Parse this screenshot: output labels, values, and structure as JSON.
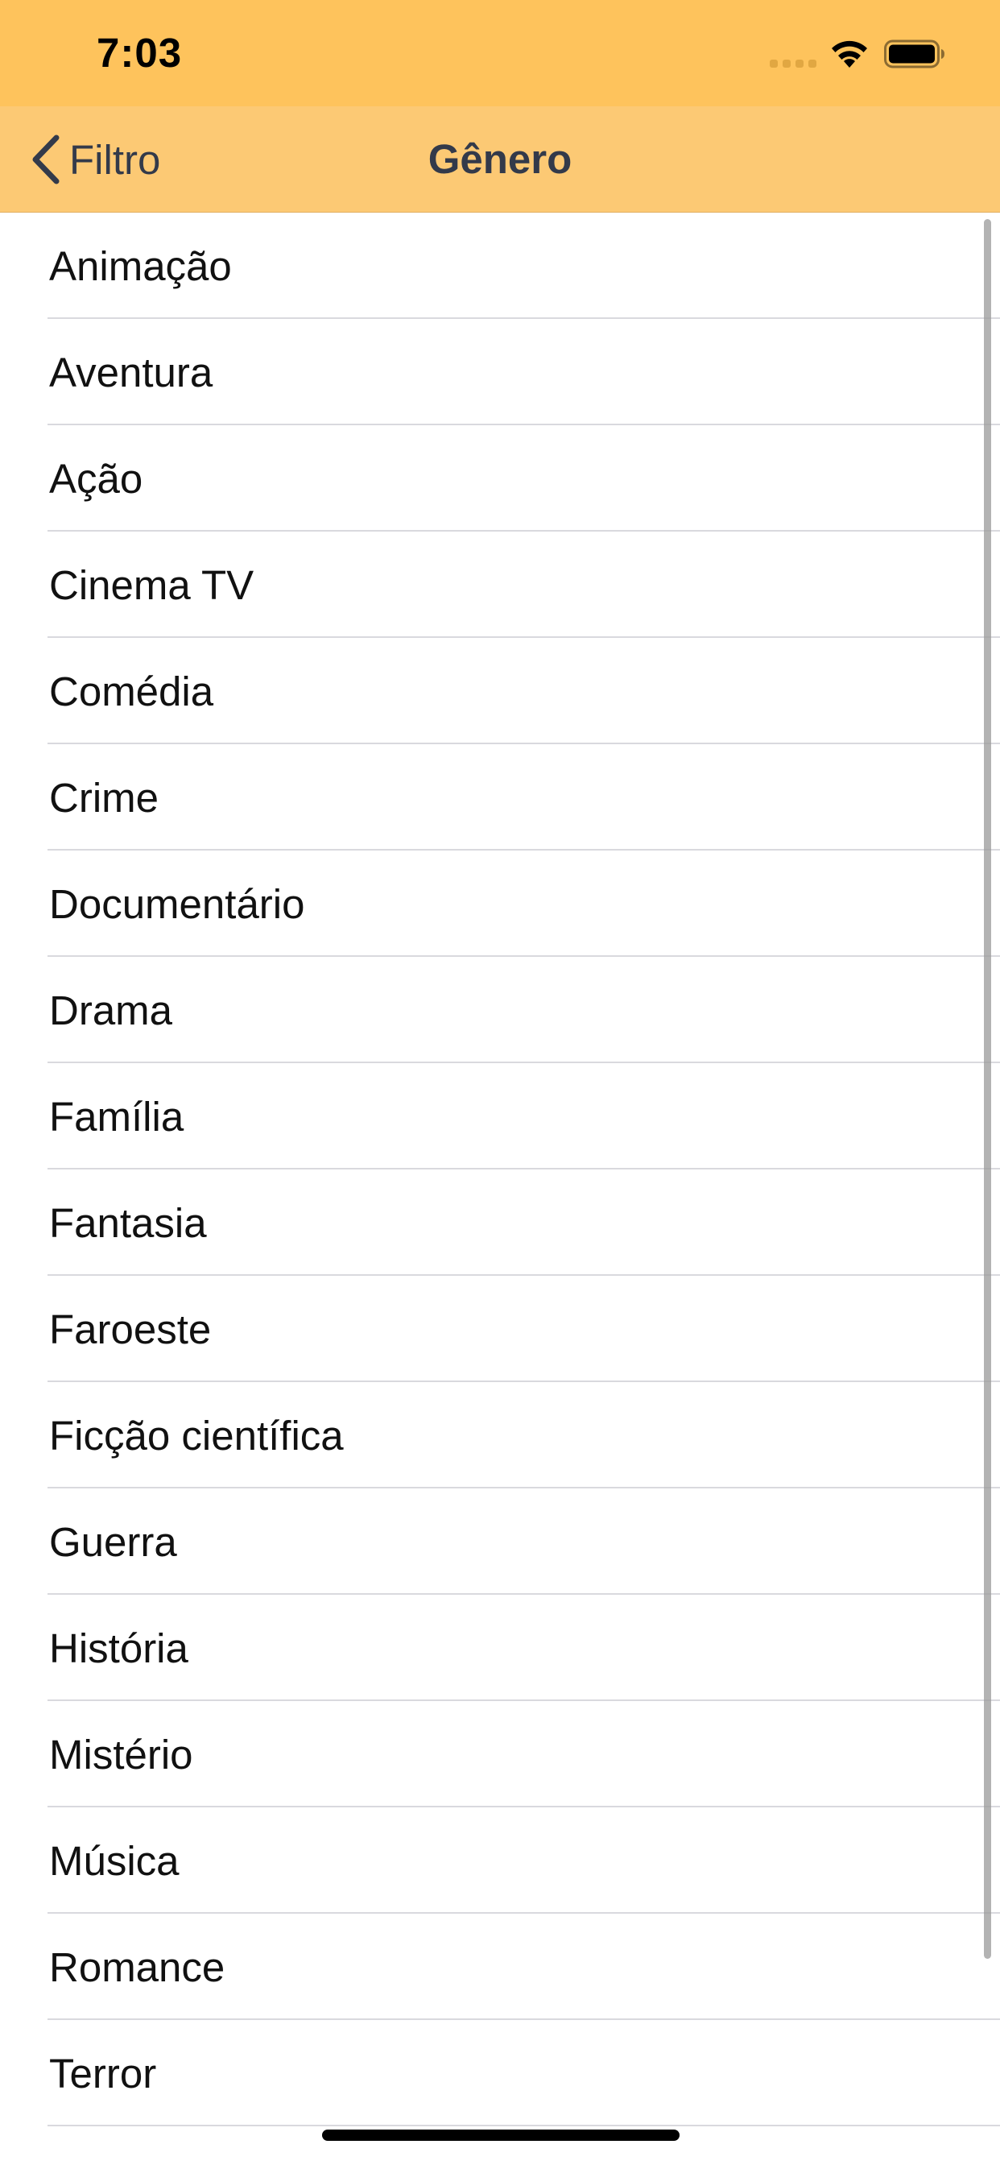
{
  "status_bar": {
    "time": "7:03",
    "icons": [
      "signal-icon",
      "wifi-icon",
      "battery-icon"
    ]
  },
  "nav": {
    "back_label": "Filtro",
    "title": "Gênero"
  },
  "genres": [
    {
      "label": "Animação"
    },
    {
      "label": "Aventura"
    },
    {
      "label": "Ação"
    },
    {
      "label": "Cinema TV"
    },
    {
      "label": "Comédia"
    },
    {
      "label": "Crime"
    },
    {
      "label": "Documentário"
    },
    {
      "label": "Drama"
    },
    {
      "label": "Família"
    },
    {
      "label": "Fantasia"
    },
    {
      "label": "Faroeste"
    },
    {
      "label": "Ficção científica"
    },
    {
      "label": "Guerra"
    },
    {
      "label": "História"
    },
    {
      "label": "Mistério"
    },
    {
      "label": "Música"
    },
    {
      "label": "Romance"
    },
    {
      "label": "Terror"
    }
  ],
  "colors": {
    "status_bar_bg": "#FEC35C",
    "nav_bar_bg": "#FCC974",
    "nav_text": "#333A4A",
    "list_bg": "#FFFFFF",
    "separator": "#D9D9DE"
  }
}
